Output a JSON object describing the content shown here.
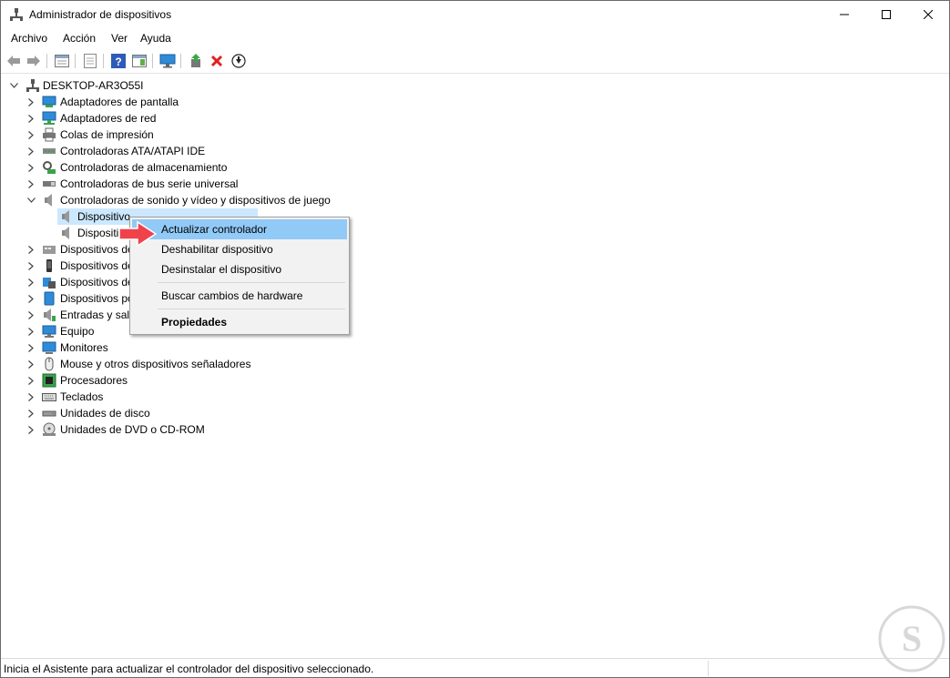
{
  "window": {
    "title": "Administrador de dispositivos",
    "app_icon": "device-manager-icon"
  },
  "menubar": {
    "items": [
      "Archivo",
      "Acción",
      "Ver",
      "Ayuda"
    ]
  },
  "toolbar": {
    "buttons": [
      "back-icon",
      "forward-icon",
      "properties-view-icon",
      "print-icon",
      "help-icon",
      "show-hide-pane-icon",
      "scan-hardware-icon",
      "add-driver-icon",
      "uninstall-icon",
      "update-driver-icon"
    ]
  },
  "tree": {
    "root": "DESKTOP-AR3O55I",
    "categories": [
      {
        "label": "Adaptadores de pantalla",
        "icon": "display-adapter-icon"
      },
      {
        "label": "Adaptadores de red",
        "icon": "network-adapter-icon"
      },
      {
        "label": "Colas de impresión",
        "icon": "print-queue-icon"
      },
      {
        "label": "Controladoras ATA/ATAPI IDE",
        "icon": "ide-controller-icon"
      },
      {
        "label": "Controladoras de almacenamiento",
        "icon": "storage-controller-icon"
      },
      {
        "label": "Controladoras de bus serie universal",
        "icon": "usb-controller-icon"
      },
      {
        "label": "Controladoras de sonido y vídeo y dispositivos de juego",
        "icon": "speaker-icon",
        "expanded": true,
        "children": [
          {
            "label": "Dispositivo de High Definition Audio",
            "visible_label": "Dispositivo",
            "selected": true
          },
          {
            "label": "Dispositivo",
            "visible_label": "Dispositivo"
          }
        ]
      },
      {
        "label": "Dispositivos de",
        "icon": "hid-icon"
      },
      {
        "label": "Dispositivos de",
        "icon": "portable-device-icon"
      },
      {
        "label": "Dispositivos de",
        "icon": "software-device-icon"
      },
      {
        "label": "Dispositivos po",
        "icon": "portable-icon"
      },
      {
        "label": "Entradas y sali",
        "icon": "audio-io-icon"
      },
      {
        "label": "Equipo",
        "icon": "computer-icon"
      },
      {
        "label": "Monitores",
        "icon": "monitor-icon"
      },
      {
        "label": "Mouse y otros dispositivos señaladores",
        "icon": "mouse-icon"
      },
      {
        "label": "Procesadores",
        "icon": "processor-icon"
      },
      {
        "label": "Teclados",
        "icon": "keyboard-icon"
      },
      {
        "label": "Unidades de disco",
        "icon": "disk-drive-icon"
      },
      {
        "label": "Unidades de DVD o CD-ROM",
        "icon": "dvd-drive-icon"
      }
    ]
  },
  "context_menu": {
    "items": [
      {
        "label": "Actualizar controlador",
        "highlighted": true
      },
      {
        "label": "Deshabilitar dispositivo"
      },
      {
        "label": "Desinstalar el dispositivo"
      },
      {
        "label": "Buscar cambios de hardware"
      },
      {
        "label": "Propiedades",
        "bold": true
      }
    ]
  },
  "statusbar": {
    "text": "Inicia el Asistente para actualizar el controlador del dispositivo seleccionado."
  },
  "colors": {
    "selection": "#cce8ff",
    "menu_highlight": "#91c9f7",
    "arrow": "#f0424a"
  }
}
